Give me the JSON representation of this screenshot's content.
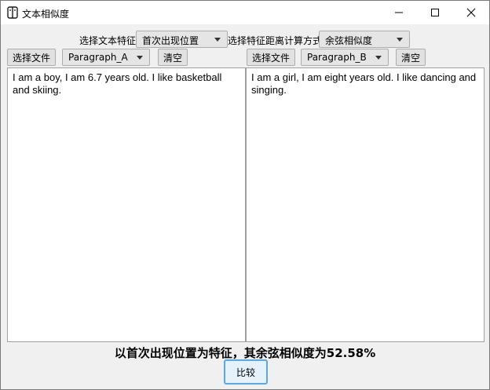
{
  "window": {
    "title": "文本相似度",
    "minimize_icon": "minimize-icon",
    "maximize_icon": "maximize-icon",
    "close_icon": "close-icon"
  },
  "options": {
    "feature_label": "选择文本特征",
    "feature_value": "首次出现位置",
    "distance_label": "选择特征距离计算方式",
    "distance_value": "余弦相似度"
  },
  "left": {
    "select_file": "选择文件",
    "paragraph": "Paragraph_A",
    "clear": "清空",
    "text": "I am a boy, I am 6.7 years old. I like basketball and skiing."
  },
  "right": {
    "select_file": "选择文件",
    "paragraph": "Paragraph_B",
    "clear": "清空",
    "text": "I am a girl, I am eight years old. I like dancing and singing."
  },
  "result": {
    "text": "以首次出现位置为特征，其余弦相似度为52.58%"
  },
  "compare_button": "比较"
}
